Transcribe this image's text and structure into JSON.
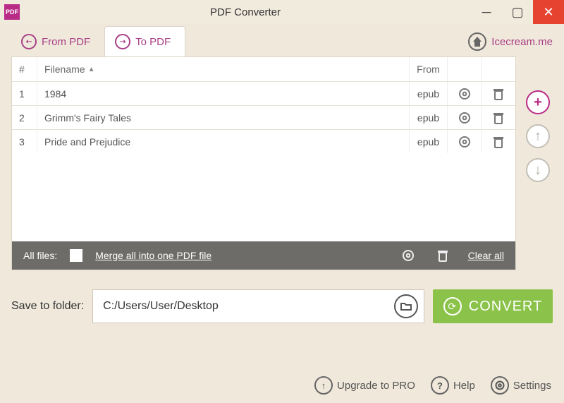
{
  "app": {
    "icon_text": "PDF",
    "title": "PDF Converter"
  },
  "tabs": {
    "from_pdf": "From PDF",
    "to_pdf": "To PDF"
  },
  "brand": {
    "label": "Icecream.me"
  },
  "table": {
    "header_num": "#",
    "header_filename": "Filename",
    "header_from": "From",
    "rows": [
      {
        "n": "1",
        "name": "1984",
        "from": "epub"
      },
      {
        "n": "2",
        "name": "Grimm's Fairy Tales",
        "from": "epub"
      },
      {
        "n": "3",
        "name": "Pride and Prejudice",
        "from": "epub"
      }
    ]
  },
  "batch": {
    "label": "All files:",
    "merge": "Merge all into one PDF file",
    "clear": "Clear all"
  },
  "save": {
    "label": "Save to folder:",
    "path": "C:/Users/User/Desktop",
    "convert": "CONVERT"
  },
  "footer": {
    "upgrade": "Upgrade to PRO",
    "help": "Help",
    "settings": "Settings"
  }
}
